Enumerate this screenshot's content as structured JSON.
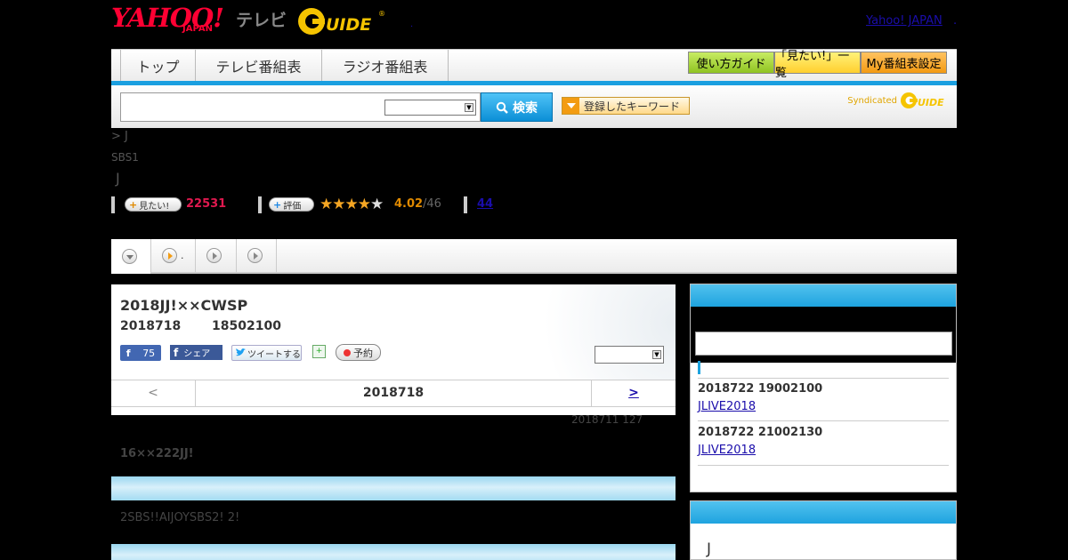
{
  "header": {
    "logo_yahoo": "YAHOO!",
    "logo_japan": "JAPAN",
    "logo_tv": "テレビ",
    "logo_gguide": "GGUIDE",
    "yahoo_japan_link": "Yahoo! JAPAN",
    "dot_right": ".",
    "dot_mid": "."
  },
  "nav": {
    "tabs": [
      {
        "label": "トップ"
      },
      {
        "label": "テレビ番組表"
      },
      {
        "label": "ラジオ番組表"
      }
    ],
    "buttons": [
      {
        "label": "使い方ガイド"
      },
      {
        "label": "「見たい!」一覧"
      },
      {
        "label": "My番組表設定"
      }
    ]
  },
  "search": {
    "input_value": "",
    "select_value": "",
    "button_label": "検索",
    "keyword_button_label": "登録したキーワード",
    "syndicated_label": "Syndicated",
    "syndicated_logo": "GGUIDE"
  },
  "program": {
    "breadcrumb": "> J",
    "channel": "SBS1",
    "title": "J",
    "want_button_label": "見たい!",
    "want_count": "22531",
    "rate_button_label": "評価",
    "rating_stars": 4,
    "rating_max": 5,
    "rating": "4.02",
    "rating_total": "/46",
    "review_count": "44"
  },
  "tabs": [
    {
      "label": ""
    },
    {
      "label": "."
    },
    {
      "label": ""
    },
    {
      "label": ""
    }
  ],
  "episode": {
    "title": "2018JJ!××CWSP",
    "date": "2018718",
    "time": "18502100",
    "fb_like_count": "75",
    "fb_share_label": "シェア",
    "tweet_label": "ツイートする",
    "reserve_label": "予約",
    "select_value": "",
    "pager_prev": "<",
    "pager_current": "2018718",
    "pager_next": ">",
    "updated": "2018711  127",
    "summary": "16××222JJ!",
    "cast": "2SBS!!AIJOYSBS2! 2!"
  },
  "sidebar": {
    "input_value": "",
    "items": [
      {
        "time": "2018722  19002100",
        "link": "JLIVE2018"
      },
      {
        "time": "2018722  21002130",
        "link": "JLIVE2018"
      }
    ],
    "box2_text": "J"
  },
  "colors": {
    "accent_blue": "#1ea3df",
    "nav_green": "#9bcc2e",
    "nav_yellow": "#ffd43b",
    "nav_orange": "#f39c12",
    "want_pink": "#e0194f",
    "rating_orange": "#e08a00",
    "link_blue": "#1a0dab"
  }
}
